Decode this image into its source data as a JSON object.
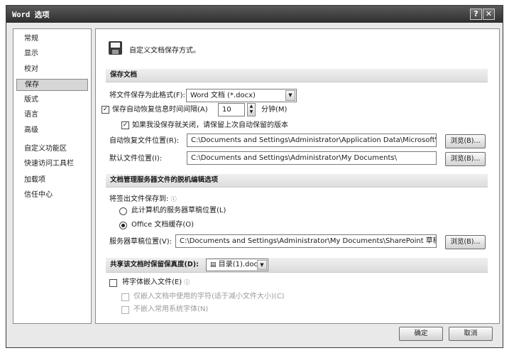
{
  "window": {
    "title": "Word 选项",
    "help": "?",
    "close": "✕"
  },
  "sidebar": {
    "items": [
      "常规",
      "显示",
      "校对",
      "保存",
      "版式",
      "语言",
      "高级",
      "自定义功能区",
      "快速访问工具栏",
      "加载项",
      "信任中心"
    ],
    "selected": "保存"
  },
  "header": {
    "text": "自定义文档保存方式。",
    "icon": "save-icon"
  },
  "save_docs": {
    "title": "保存文档",
    "format_label": "将文件保存为此格式(F):",
    "format_value": "Word 文档 (*.docx)",
    "autorecover_label": "保存自动恢复信息时间间隔(A)",
    "autorecover_value": "10",
    "minutes_label": "分钟(M)",
    "keep_last_label": "如果我没保存就关闭，请保留上次自动保留的版本",
    "autorecover_path_label": "自动恢复文件位置(R):",
    "autorecover_path": "C:\\Documents and Settings\\Administrator\\Application Data\\Microsoft\\Wor",
    "default_path_label": "默认文件位置(I):",
    "default_path": "C:\\Documents and Settings\\Administrator\\My Documents\\",
    "browse_label": "浏览(B)..."
  },
  "offline": {
    "title": "文档管理服务器文件的脱机编辑选项",
    "save_to_label": "将签出文件保存到:",
    "option_server": "此计算机的服务器草稿位置(L)",
    "option_cache": "Office 文档缓存(O)",
    "drafts_label": "服务器草稿位置(V):",
    "drafts_path": "C:\\Documents and Settings\\Administrator\\My Documents\\SharePoint 草稿\\",
    "browse_label": "浏览(B)..."
  },
  "fidelity": {
    "title": "共享该文档时保留保真度(D):",
    "doc_value": "目录(1).doc",
    "embed_fonts": "将字体嵌入文件(E)",
    "embed_only_used": "仅嵌入文档中使用的字符(适于减小文件大小)(C)",
    "no_system_fonts": "不嵌入常用系统字体(N)"
  },
  "footer": {
    "ok": "确定",
    "cancel": "取消"
  }
}
